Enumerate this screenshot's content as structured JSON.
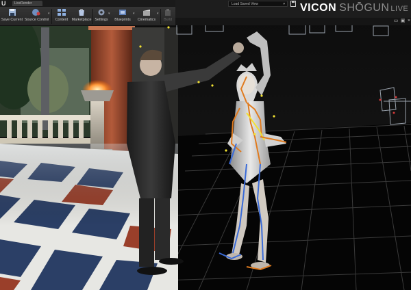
{
  "editor": {
    "level_tab": "LiveRender"
  },
  "toolbar": {
    "buttons": [
      {
        "label": "Save Current",
        "icon": "save-icon"
      },
      {
        "label": "Source Control",
        "icon": "source-control-icon"
      },
      {
        "label": "Content",
        "icon": "content-browser-icon"
      },
      {
        "label": "Marketplace",
        "icon": "marketplace-icon"
      },
      {
        "label": "Settings",
        "icon": "settings-icon"
      },
      {
        "label": "Blueprints",
        "icon": "blueprints-icon"
      },
      {
        "label": "Cinematics",
        "icon": "cinematics-icon"
      },
      {
        "label": "Build",
        "icon": "build-icon"
      }
    ]
  },
  "viewer": {
    "saved_view_label": "Load Saved View",
    "brand_main": "VICON",
    "brand_product": "SHŌGUN",
    "brand_edition": "LIVE"
  },
  "colors": {
    "toolbar_bg": "#2c2c2c",
    "header_bg": "#1d1d1d",
    "floor_grid": "#3a3a3a",
    "skeleton_orange": "#e07b1f",
    "skeleton_yellow": "#f2e233",
    "skeleton_blue": "#3a6bd8",
    "camera_frustum": "#9aa3ad",
    "brazier_fire": "#ff9a3c"
  }
}
